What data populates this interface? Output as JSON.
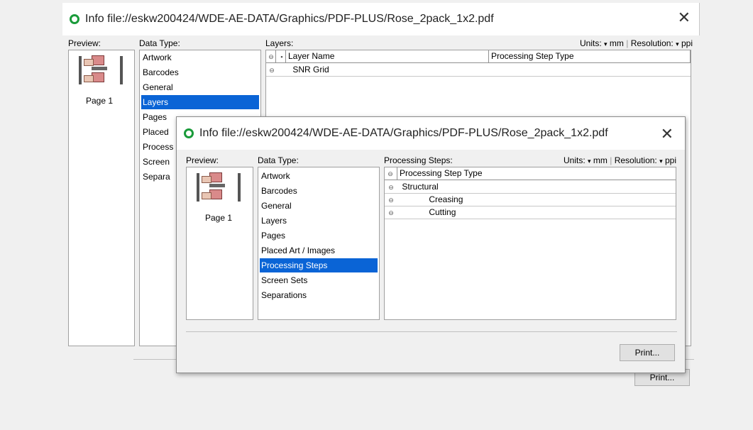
{
  "back_window": {
    "title": "Info file://eskw200424/WDE-AE-DATA/Graphics/PDF-PLUS/Rose_2pack_1x2.pdf",
    "preview_label": "Preview:",
    "page_label": "Page 1",
    "data_type_label": "Data Type:",
    "data_types": [
      "Artwork",
      "Barcodes",
      "General",
      "Layers",
      "Pages",
      "Placed",
      "Process",
      "Screen",
      "Separa"
    ],
    "selected_index": 3,
    "panel_label": "Layers:",
    "units_label": "Units:",
    "units_value": "mm",
    "resolution_label": "Resolution:",
    "resolution_value": "ppi",
    "columns": [
      "Layer Name",
      "Processing Step Type"
    ],
    "rows": [
      {
        "name": "SNR Grid",
        "type": ""
      }
    ],
    "print_label": "Print..."
  },
  "front_window": {
    "title": "Info file://eskw200424/WDE-AE-DATA/Graphics/PDF-PLUS/Rose_2pack_1x2.pdf",
    "preview_label": "Preview:",
    "page_label": "Page 1",
    "data_type_label": "Data Type:",
    "data_types": [
      "Artwork",
      "Barcodes",
      "General",
      "Layers",
      "Pages",
      "Placed Art / Images",
      "Processing Steps",
      "Screen Sets",
      "Separations"
    ],
    "selected_index": 6,
    "panel_label": "Processing Steps:",
    "units_label": "Units:",
    "units_value": "mm",
    "resolution_label": "Resolution:",
    "resolution_value": "ppi",
    "column": "Processing Step Type",
    "rows": [
      "Structural",
      "Creasing",
      "Cutting"
    ],
    "print_label": "Print..."
  },
  "colors": {
    "selection": "#0a64d6",
    "title_icon": "#1a9b3a"
  }
}
